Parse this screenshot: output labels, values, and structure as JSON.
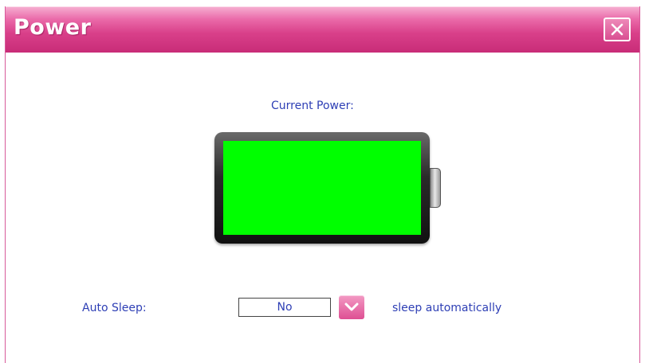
{
  "window": {
    "title": "Power",
    "close_icon": "close-icon"
  },
  "power": {
    "label": "Current Power:",
    "level": 1.0,
    "fill_color": "#00ff00"
  },
  "auto_sleep": {
    "label": "Auto Sleep:",
    "selected_value": "No",
    "description": "sleep automatically",
    "dropdown_icon": "chevron-down-icon"
  },
  "colors": {
    "accent": "#d9408a",
    "label_text": "#2e3fb5"
  }
}
